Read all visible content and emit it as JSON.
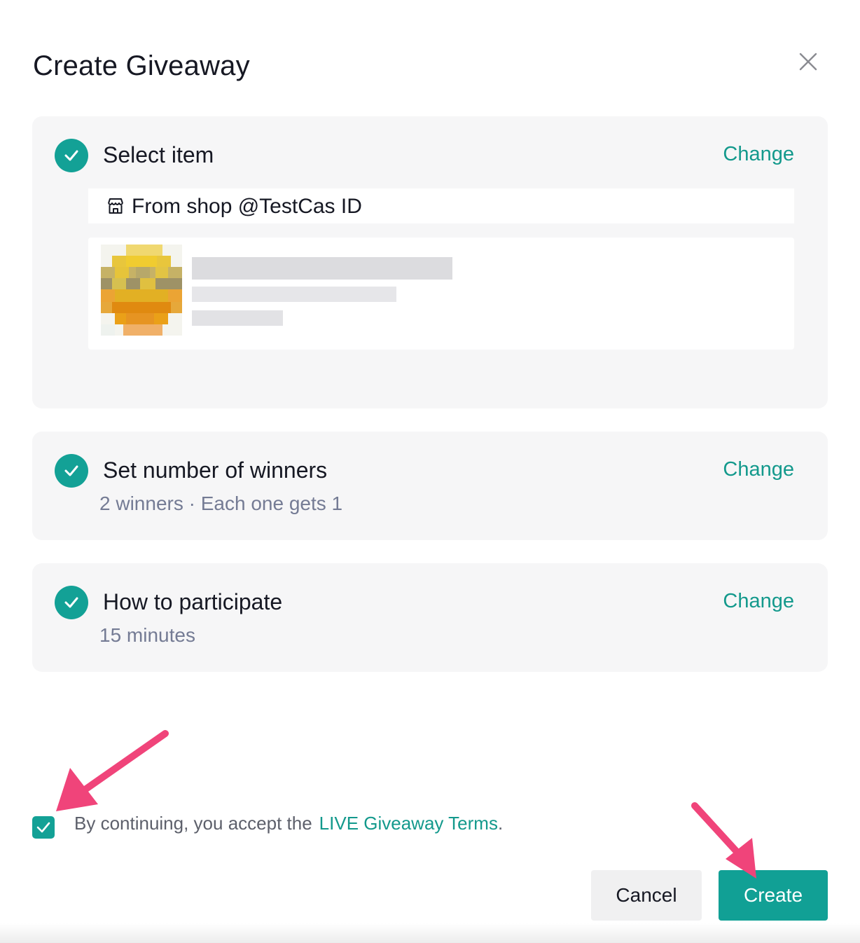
{
  "dialog": {
    "title": "Create Giveaway"
  },
  "steps": [
    {
      "title": "Select item",
      "change_label": "Change",
      "shop_label": "From shop @TestCas ID"
    },
    {
      "title": "Set number of winners",
      "change_label": "Change",
      "subtitle": "2 winners · Each one gets 1"
    },
    {
      "title": "How to participate",
      "change_label": "Change",
      "subtitle": "15 minutes"
    }
  ],
  "terms": {
    "checked": true,
    "prefix": "By continuing, you accept the",
    "link": "LIVE Giveaway Terms",
    "suffix": "."
  },
  "footer": {
    "cancel_label": "Cancel",
    "create_label": "Create"
  },
  "colors": {
    "accent": "#13a196",
    "link": "#13998c",
    "card_background": "#f6f6f7",
    "annotation_arrow": "#f0447a"
  },
  "icons": {
    "close": "close-icon",
    "step_done": "check-circle-icon",
    "shop": "shop-icon",
    "checkbox": "checkmark-icon"
  }
}
